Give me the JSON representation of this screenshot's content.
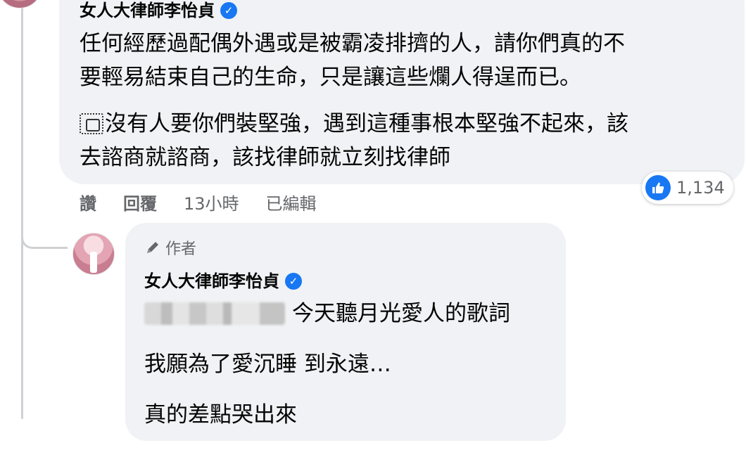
{
  "comment": {
    "author": "女人大律師李怡貞",
    "lines": [
      "任何經歷過配偶外遇或是被霸凌排擠的人，請你們真的不",
      "要輕易結束自己的生命，只是讓這些爛人得逞而已。"
    ],
    "lines2": [
      "沒有人要你們裝堅強，遇到這種事根本堅強不起來，該",
      "去諮商就諮商，該找律師就立刻找律師"
    ],
    "actions": {
      "like": "讚",
      "reply": "回覆",
      "time": "13小時",
      "edited": "已編輯"
    },
    "reaction_count": "1,134"
  },
  "reply": {
    "badge": "作者",
    "author": "女人大律師李怡貞",
    "line1": "今天聽月光愛人的歌詞",
    "line2": "我願為了愛沉睡 到永遠…",
    "line3": "真的差點哭出來"
  },
  "colors": {
    "accent": "#1877f2",
    "bubble": "#f0f2f5",
    "secondary_text": "#65676b"
  },
  "icons": [
    "verified-badge-icon",
    "emoji-placeholder-icon",
    "like-reaction-icon",
    "author-pencil-icon"
  ]
}
